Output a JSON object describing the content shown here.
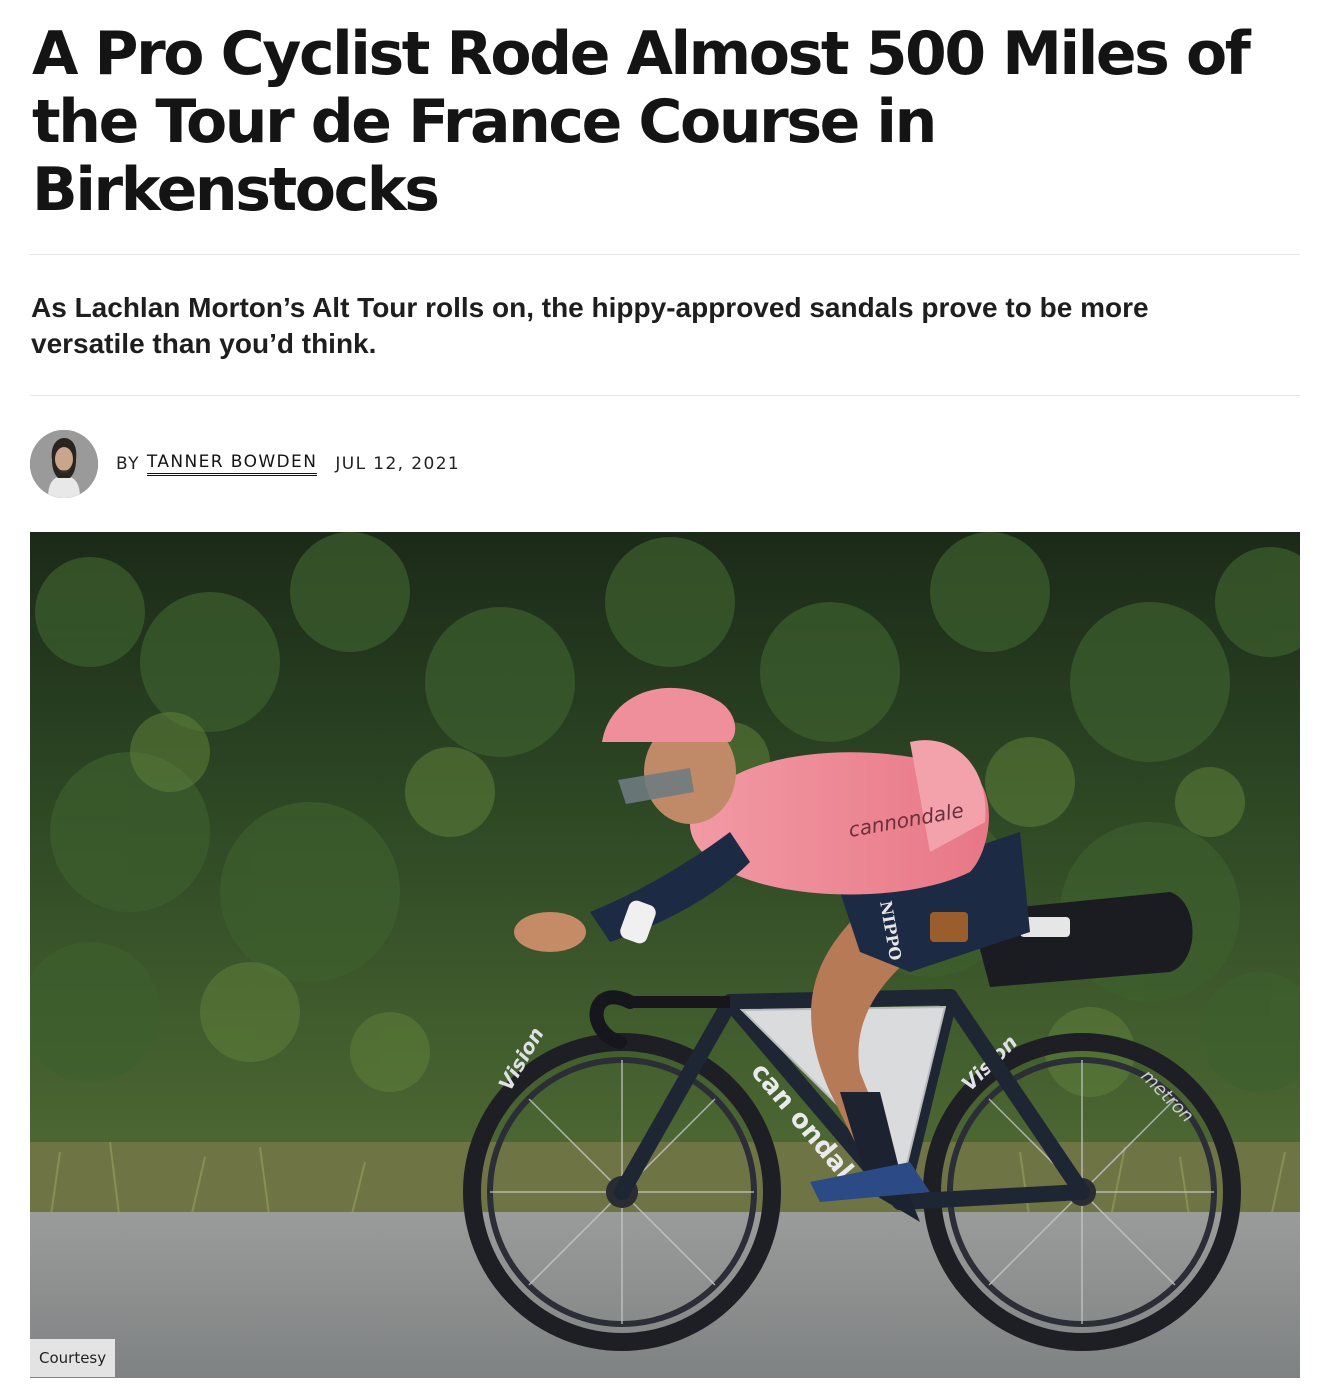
{
  "article": {
    "headline": "A Pro Cyclist Rode Almost 500 Miles of the Tour de France Course in Birkenstocks",
    "dek": "As Lachlan Morton’s Alt Tour rolls on, the hippy-approved sandals prove to be more versatile than you’d think.",
    "byline": {
      "by_label": "BY",
      "author": "TANNER BOWDEN",
      "date": "JUL 12, 2021"
    },
    "hero_image": {
      "credit": "Courtesy",
      "jersey_text": "cannondale",
      "shorts_text": "NIPPO",
      "frame_text": "can ondal",
      "rim_text": "Vision",
      "rim_text_2": "metron"
    }
  },
  "colors": {
    "headline": "#141414",
    "jersey_pink": "#ee8a96",
    "foliage": "#2f4a25",
    "road": "#8a8c8c"
  }
}
